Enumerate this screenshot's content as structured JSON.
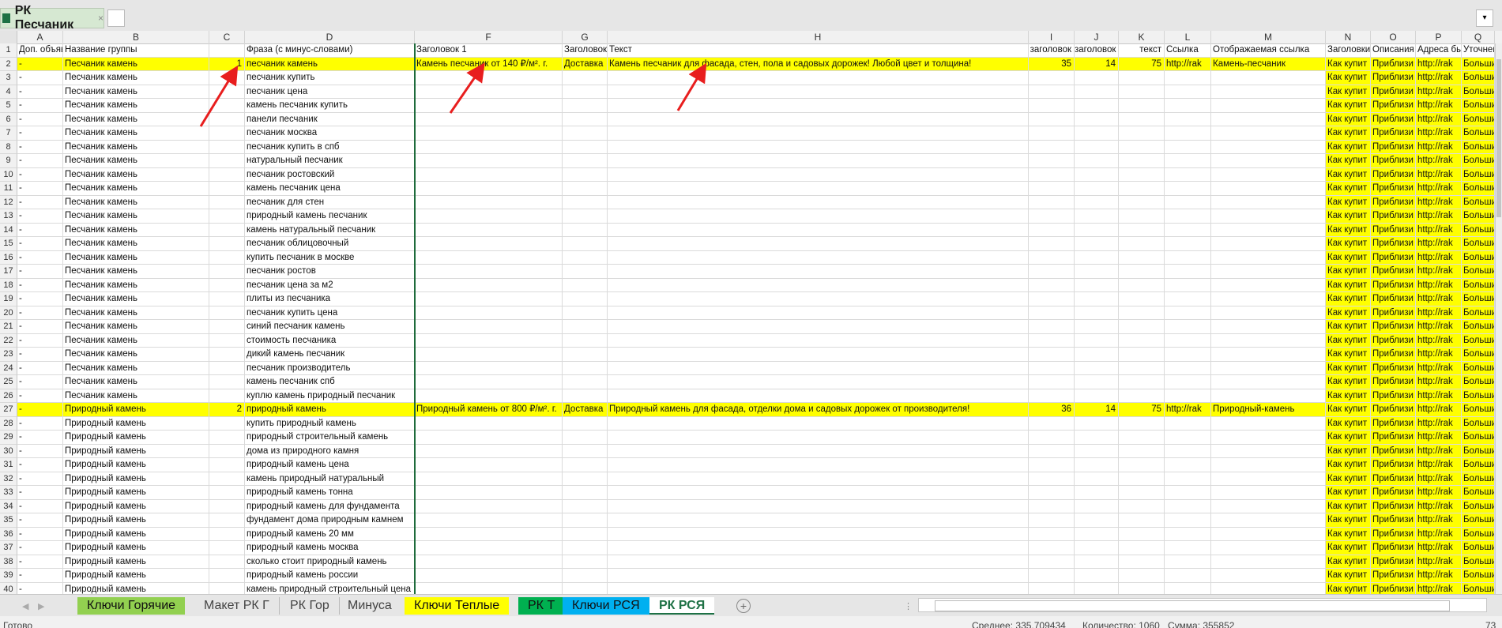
{
  "workbook": {
    "title": "РК Песчаник",
    "close": "×",
    "dropdown": "▾"
  },
  "columns": [
    "A",
    "B",
    "C",
    "D",
    "F",
    "G",
    "H",
    "I",
    "J",
    "K",
    "L",
    "M",
    "N",
    "O",
    "P",
    "Q"
  ],
  "header_row": [
    "Доп. объяв",
    "Название группы",
    "",
    "Фраза (с минус-словами)",
    "Заголовок 1",
    "Заголовок",
    "Текст",
    "заголовок",
    "заголовок",
    "текст",
    "Ссылка",
    "Отображаемая ссылка",
    "Заголовки",
    "Описания",
    "Адреса бы",
    "Уточнен"
  ],
  "rows": [
    {
      "n": "2",
      "a": "-",
      "b": "Песчаник камень",
      "c": "1",
      "d": "песчаник камень",
      "f": "Камень песчаник от 140 ₽/м². г.",
      "g": "Доставка",
      "h": "Камень песчаник для фасада, стен, пола и садовых дорожек! Любой цвет и толщина!",
      "i": "35",
      "j": "14",
      "k": "75",
      "l": "http://rak",
      "m": "Камень-песчаник",
      "hl": true
    },
    {
      "n": "3",
      "a": "-",
      "b": "Песчаник камень",
      "d": "песчаник купить"
    },
    {
      "n": "4",
      "a": "-",
      "b": "Песчаник камень",
      "d": "песчаник цена"
    },
    {
      "n": "5",
      "a": "-",
      "b": "Песчаник камень",
      "d": "камень песчаник купить"
    },
    {
      "n": "6",
      "a": "-",
      "b": "Песчаник камень",
      "d": "панели песчаник"
    },
    {
      "n": "7",
      "a": "-",
      "b": "Песчаник камень",
      "d": "песчаник москва"
    },
    {
      "n": "8",
      "a": "-",
      "b": "Песчаник камень",
      "d": "песчаник купить в спб"
    },
    {
      "n": "9",
      "a": "-",
      "b": "Песчаник камень",
      "d": "натуральный песчаник"
    },
    {
      "n": "10",
      "a": "-",
      "b": "Песчаник камень",
      "d": "песчаник ростовский"
    },
    {
      "n": "11",
      "a": "-",
      "b": "Песчаник камень",
      "d": "камень песчаник цена"
    },
    {
      "n": "12",
      "a": "-",
      "b": "Песчаник камень",
      "d": "песчаник для стен"
    },
    {
      "n": "13",
      "a": "-",
      "b": "Песчаник камень",
      "d": "природный камень песчаник"
    },
    {
      "n": "14",
      "a": "-",
      "b": "Песчаник камень",
      "d": "камень натуральный песчаник"
    },
    {
      "n": "15",
      "a": "-",
      "b": "Песчаник камень",
      "d": "песчаник облицовочный"
    },
    {
      "n": "16",
      "a": "-",
      "b": "Песчаник камень",
      "d": "купить песчаник в москве"
    },
    {
      "n": "17",
      "a": "-",
      "b": "Песчаник камень",
      "d": "песчаник ростов"
    },
    {
      "n": "18",
      "a": "-",
      "b": "Песчаник камень",
      "d": "песчаник цена за м2"
    },
    {
      "n": "19",
      "a": "-",
      "b": "Песчаник камень",
      "d": "плиты из песчаника"
    },
    {
      "n": "20",
      "a": "-",
      "b": "Песчаник камень",
      "d": "песчаник купить цена"
    },
    {
      "n": "21",
      "a": "-",
      "b": "Песчаник камень",
      "d": "синий песчаник камень"
    },
    {
      "n": "22",
      "a": "-",
      "b": "Песчаник камень",
      "d": "стоимость песчаника"
    },
    {
      "n": "23",
      "a": "-",
      "b": "Песчаник камень",
      "d": "дикий камень песчаник"
    },
    {
      "n": "24",
      "a": "-",
      "b": "Песчаник камень",
      "d": "песчаник производитель"
    },
    {
      "n": "25",
      "a": "-",
      "b": "Песчаник камень",
      "d": "камень песчаник спб"
    },
    {
      "n": "26",
      "a": "-",
      "b": "Песчаник камень",
      "d": "куплю камень природный песчаник"
    },
    {
      "n": "27",
      "a": "-",
      "b": "Природный камень",
      "c": "2",
      "d": "природный камень",
      "f": "Природный камень от 800 ₽/м². г.",
      "g": "Доставка",
      "h": "Природный камень для фасада, отделки дома и садовых дорожек от производителя!",
      "i": "36",
      "j": "14",
      "k": "75",
      "l": "http://rak",
      "m": "Природный-камень",
      "hl": true
    },
    {
      "n": "28",
      "a": "-",
      "b": "Природный камень",
      "d": "купить природный камень"
    },
    {
      "n": "29",
      "a": "-",
      "b": "Природный камень",
      "d": "природный строительный камень"
    },
    {
      "n": "30",
      "a": "-",
      "b": "Природный камень",
      "d": "дома из природного камня"
    },
    {
      "n": "31",
      "a": "-",
      "b": "Природный камень",
      "d": "природный камень цена"
    },
    {
      "n": "32",
      "a": "-",
      "b": "Природный камень",
      "d": "камень природный натуральный"
    },
    {
      "n": "33",
      "a": "-",
      "b": "Природный камень",
      "d": "природный камень тонна"
    },
    {
      "n": "34",
      "a": "-",
      "b": "Природный камень",
      "d": "природный камень для фундамента"
    },
    {
      "n": "35",
      "a": "-",
      "b": "Природный камень",
      "d": "фундамент дома природным камнем"
    },
    {
      "n": "36",
      "a": "-",
      "b": "Природный камень",
      "d": "природный камень 20 мм"
    },
    {
      "n": "37",
      "a": "-",
      "b": "Природный камень",
      "d": "природный камень москва"
    },
    {
      "n": "38",
      "a": "-",
      "b": "Природный камень",
      "d": "сколько стоит природный камень"
    },
    {
      "n": "39",
      "a": "-",
      "b": "Природный камень",
      "d": "природный камень россии"
    },
    {
      "n": "40",
      "a": "-",
      "b": "Природный камень",
      "d": "камень природный строительный цена"
    }
  ],
  "right_cols": {
    "n": "Как купит",
    "o": "Приблизи",
    "p": "http://rak",
    "q": "Больши"
  },
  "sheets": [
    {
      "label": "Ключи Горячие",
      "style": "green"
    },
    {
      "label": "Макет РК Г",
      "style": "sep"
    },
    {
      "label": "РК Гор",
      "style": "sep"
    },
    {
      "label": "Минуса",
      "style": "plain"
    },
    {
      "label": "Ключи Теплые",
      "style": "yellow"
    },
    {
      "label": "РК Т",
      "style": "dgreen"
    },
    {
      "label": "Ключи РСЯ",
      "style": "blue"
    },
    {
      "label": "РК РСЯ",
      "style": "active"
    }
  ],
  "add_sheet": "+",
  "status": {
    "ready": "Готово",
    "average": "Среднее: 335,709434",
    "count": "Количество: 1060",
    "sum": "Сумма: 355852",
    "zoom": "73"
  },
  "colors": {
    "highlight": "#ffff00",
    "tab_green": "#92d050",
    "tab_dgreen": "#00b050",
    "tab_blue": "#00b0f0",
    "annotation_arrow": "#e81e1e"
  }
}
